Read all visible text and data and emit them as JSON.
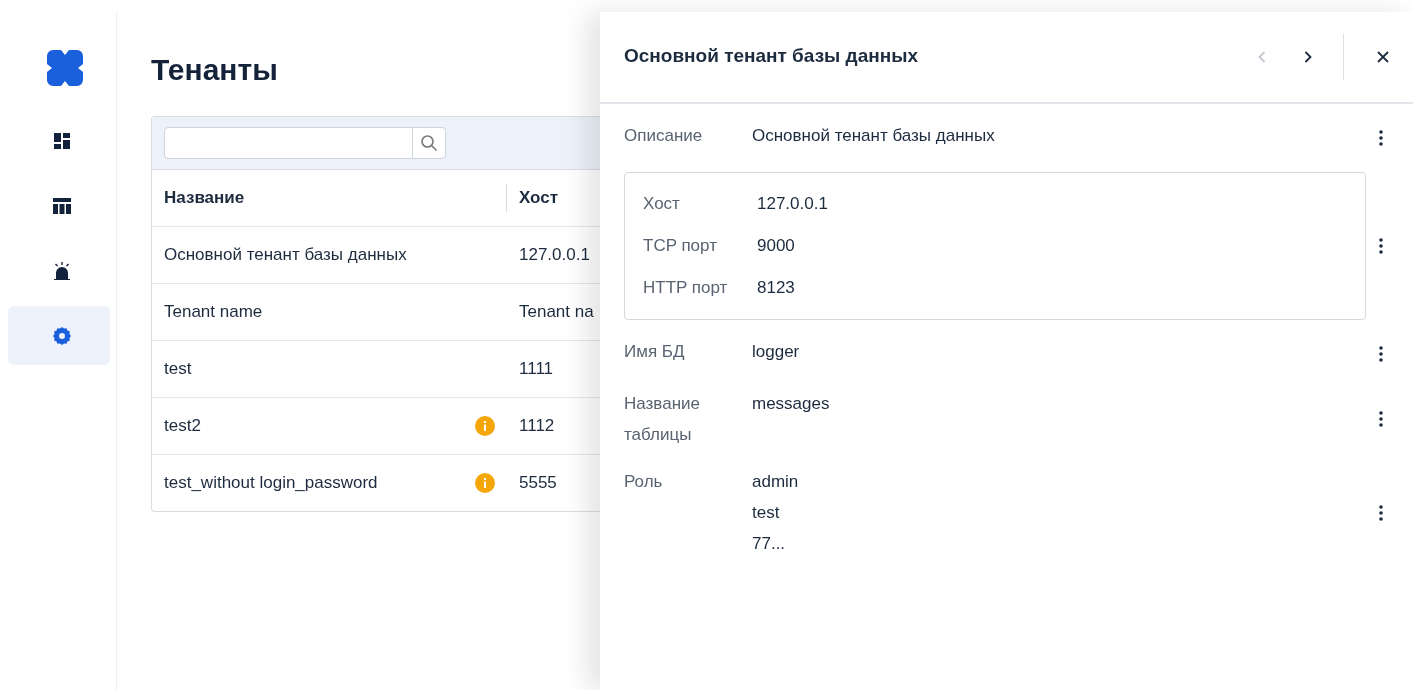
{
  "sidebar": {
    "items": [
      {
        "kind": "dashboard",
        "selected": false
      },
      {
        "kind": "table",
        "selected": false
      },
      {
        "kind": "alarm",
        "selected": false
      },
      {
        "kind": "settings",
        "selected": true
      }
    ]
  },
  "page": {
    "title": "Тенанты"
  },
  "table": {
    "columns": [
      "Название",
      "Хост"
    ],
    "rows": [
      {
        "cells": [
          "Основной тенант базы данных",
          "127.0.0.1"
        ],
        "warning": false
      },
      {
        "cells": [
          "Tenant name",
          "Tenant na"
        ],
        "warning": false
      },
      {
        "cells": [
          "test",
          "1111"
        ],
        "warning": false
      },
      {
        "cells": [
          "test2",
          "1112"
        ],
        "warning": true
      },
      {
        "cells": [
          "test_without login_password",
          "5555"
        ],
        "warning": true
      }
    ]
  },
  "drawer": {
    "title": "Основной тенант базы данных",
    "prev_disabled": true,
    "next_disabled": false,
    "fields": [
      {
        "kind": "field",
        "label": "Описание",
        "value": [
          "Основной тенант базы данных"
        ]
      },
      {
        "kind": "group",
        "items": [
          {
            "label": "Хост",
            "value": "127.0.0.1"
          },
          {
            "label": "TCP порт",
            "value": "9000"
          },
          {
            "label": "HTTP порт",
            "value": "8123"
          }
        ]
      },
      {
        "kind": "field",
        "label": "Имя БД",
        "value": [
          "logger"
        ]
      },
      {
        "kind": "field",
        "label": "Название таблицы",
        "value": [
          "messages"
        ]
      },
      {
        "kind": "field",
        "label": "Роль",
        "value": [
          "admin",
          "test",
          "77..."
        ]
      }
    ]
  }
}
